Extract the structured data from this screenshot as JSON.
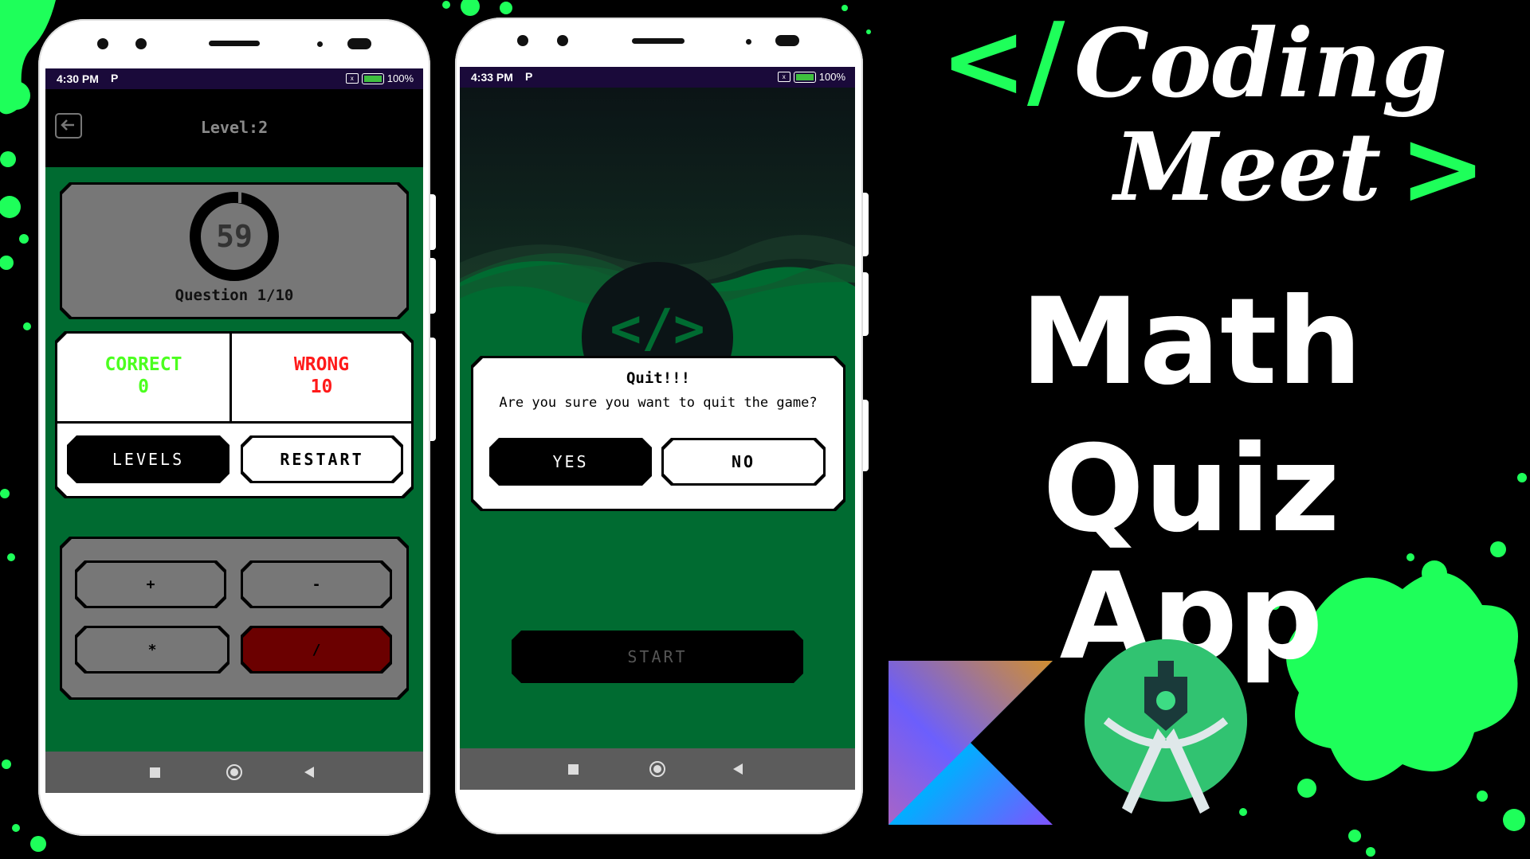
{
  "phone1": {
    "status_time": "4:30 PM",
    "status_p": "P",
    "battery": "100%",
    "header_title": "Level:2",
    "timer_value": "59",
    "question_label": "Question 1/10",
    "correct_label": "CORRECT",
    "correct_value": "0",
    "wrong_label": "WRONG",
    "wrong_value": "10",
    "levels_button": "LEVELS",
    "restart_button": "RESTART",
    "ops": [
      "+",
      "-",
      "*",
      "/"
    ]
  },
  "phone2": {
    "status_time": "4:33 PM",
    "status_p": "P",
    "battery": "100%",
    "logo_text": "</>",
    "dialog_title": "Quit!!!",
    "dialog_message": "Are you sure you want to quit the game?",
    "yes_button": "YES",
    "no_button": "NO",
    "start_button": "START"
  },
  "branding": {
    "logo_open": "</",
    "logo_word1": "Coding",
    "logo_word2": "Meet",
    "logo_close": ">",
    "title_line1": "Math",
    "title_line2": "Quiz App"
  },
  "colors": {
    "accent_green": "#1eff5a",
    "screen_green": "#006b31",
    "correct_green": "#4cff1f",
    "wrong_red": "#ff1a1a"
  }
}
